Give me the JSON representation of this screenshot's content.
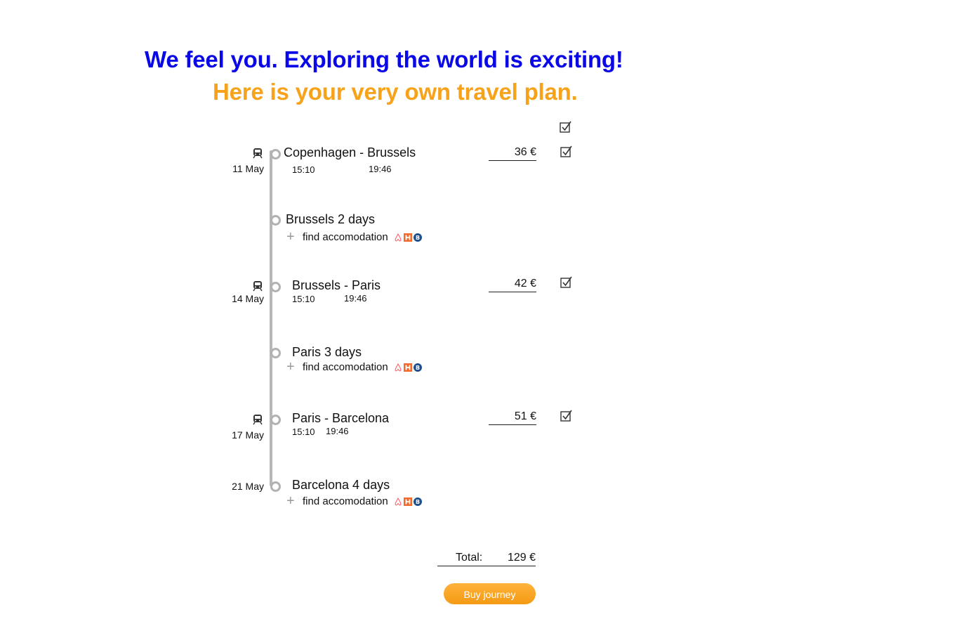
{
  "header": {
    "line1": "We feel you. Exploring the world is exciting!",
    "line2": "Here is your very own travel plan."
  },
  "colors": {
    "headline": "#0b08e8",
    "subheadline": "#f7a21b",
    "button": "#f7a21b",
    "timeline": "#b7b7b7"
  },
  "legs": [
    {
      "title": "Copenhagen - Brussels",
      "date": "11 May",
      "depart": "15:10",
      "arrive": "19:46",
      "price": "36 €",
      "icon": "train-icon"
    },
    {
      "title": "Brussels - Paris",
      "date": "14 May",
      "depart": "15:10",
      "arrive": "19:46",
      "price": "42 €",
      "icon": "train-icon"
    },
    {
      "title": "Paris - Barcelona",
      "date": "17 May",
      "depart": "15:10",
      "arrive": "19:46",
      "price": "51 €",
      "icon": "train-icon"
    }
  ],
  "stays": [
    {
      "title": "Brussels 2 days",
      "action": "find accomodation",
      "date": ""
    },
    {
      "title": "Paris 3 days",
      "action": "find accomodation",
      "date": ""
    },
    {
      "title": "Barcelona 4 days",
      "action": "find accomodation",
      "date": "21 May"
    }
  ],
  "accommodation_icons": [
    "airbnb-icon",
    "hostel-icon",
    "booking-icon"
  ],
  "total": {
    "label": "Total:",
    "value": "129 €"
  },
  "buy_button": {
    "label": "Buy journey"
  }
}
